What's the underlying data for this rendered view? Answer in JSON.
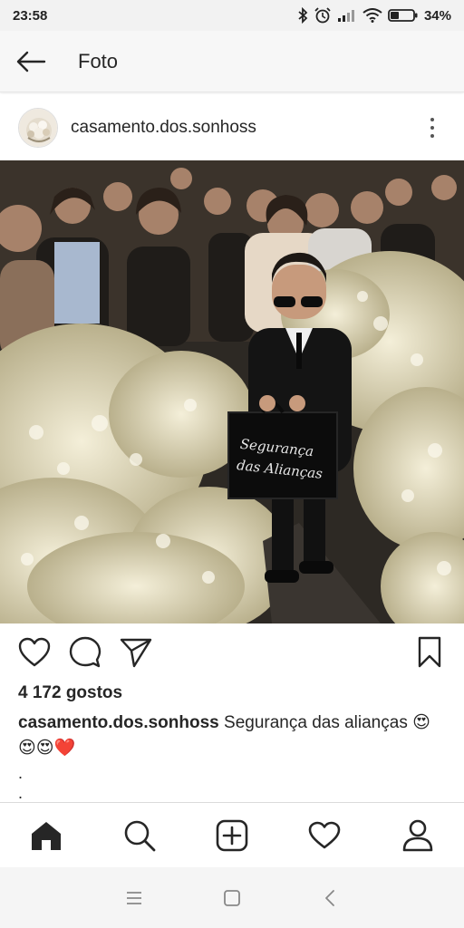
{
  "status_bar": {
    "time": "23:58",
    "battery": "34%",
    "icons": [
      "bluetooth-icon",
      "alarm-icon",
      "signal-icon",
      "wifi-icon",
      "battery-icon"
    ]
  },
  "app_bar": {
    "back_icon": "arrow-left-icon",
    "title": "Foto"
  },
  "post": {
    "username": "casamento.dos.sonhoss",
    "more_icon": "more-vertical-icon",
    "photo": {
      "bag_text_line1": "Segurança",
      "bag_text_line2": "das Alianças"
    },
    "likes": "4 172 gostos",
    "caption_user": "casamento.dos.sonhoss",
    "caption_text": "Segurança das alianças 😍",
    "caption_emojis": "😍😍❤️",
    "caption_more": [
      ".",
      "."
    ]
  },
  "actions": {
    "like_icon": "heart-icon",
    "comment_icon": "comment-icon",
    "share_icon": "send-icon",
    "save_icon": "bookmark-icon"
  },
  "bottom_nav": {
    "items": [
      "home-icon",
      "search-icon",
      "add-post-icon",
      "activity-heart-icon",
      "profile-icon"
    ]
  },
  "system_nav": {
    "items": [
      "menu-icon",
      "home-square-icon",
      "back-chevron-icon"
    ]
  },
  "colors": {
    "text": "#262626",
    "heart_red": "#e0245e",
    "status_bg": "#f2f2f2"
  }
}
